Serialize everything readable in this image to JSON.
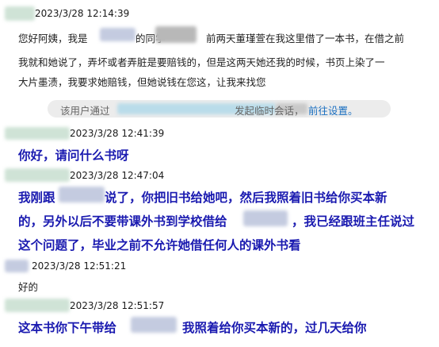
{
  "messages": [
    {
      "time": "2023/3/28 12:14:39",
      "lines": [
        "您好阿姨，我是",
        "的同学",
        "前两天董瑾萱在我这里借了一本书，在借之前",
        "我就和她说了，弄坏或者弄脏是要赔钱的，但是这两天她还我的时候，书页上染了一",
        "大片墨渍，我要求她赔钱，但她说钱在您这，让我来找您"
      ]
    },
    {
      "time": "2023/3/28 12:41:39",
      "lines": [
        "你好，请问什么书呀"
      ]
    },
    {
      "time": "2023/3/28 12:47:04",
      "lines": [
        "我刚跟",
        "说了，你把旧书给她吧，然后我照着旧书给你买本新",
        "的，另外以后不要带课外书到学校借给",
        "，我已经跟班主任说过",
        "这个问题了，毕业之前不允许她借任何人的课外书看"
      ]
    },
    {
      "time": "2023/3/28 12:51:21",
      "lines": [
        "好的"
      ]
    },
    {
      "time": "2023/3/28 12:51:57",
      "lines": [
        "这本书你下午带给",
        "我照着给你买本新的，过几天给你"
      ]
    }
  ],
  "notice": {
    "prefix": "该用户通过",
    "middle": "发起临时会话，",
    "link": "前往设置。"
  },
  "colors": {
    "bold_text": "#1a1ab0",
    "link": "#1a6fc0",
    "notice_bg": "#ececec"
  }
}
